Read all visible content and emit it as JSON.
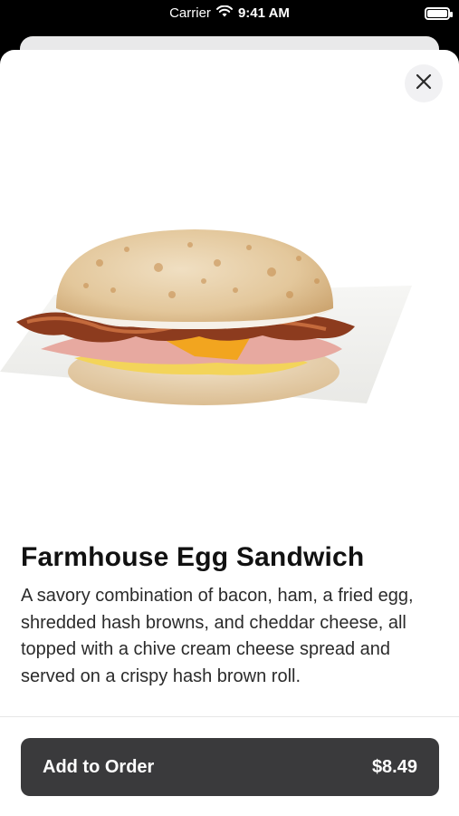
{
  "status_bar": {
    "carrier": "Carrier",
    "time": "9:41 AM"
  },
  "product": {
    "name": "Farmhouse Egg Sandwich",
    "description": "A savory combination of bacon, ham, a fried egg, shredded hash browns, and cheddar cheese, all topped with a chive cream cheese spread and served on a crispy hash brown roll.",
    "image_icon": "sandwich-image"
  },
  "order_button": {
    "label": "Add to Order",
    "price": "$8.49"
  },
  "colors": {
    "button_bg": "#3a3a3c",
    "close_bg": "#f1f1f3",
    "sheet_bg": "#ffffff"
  }
}
